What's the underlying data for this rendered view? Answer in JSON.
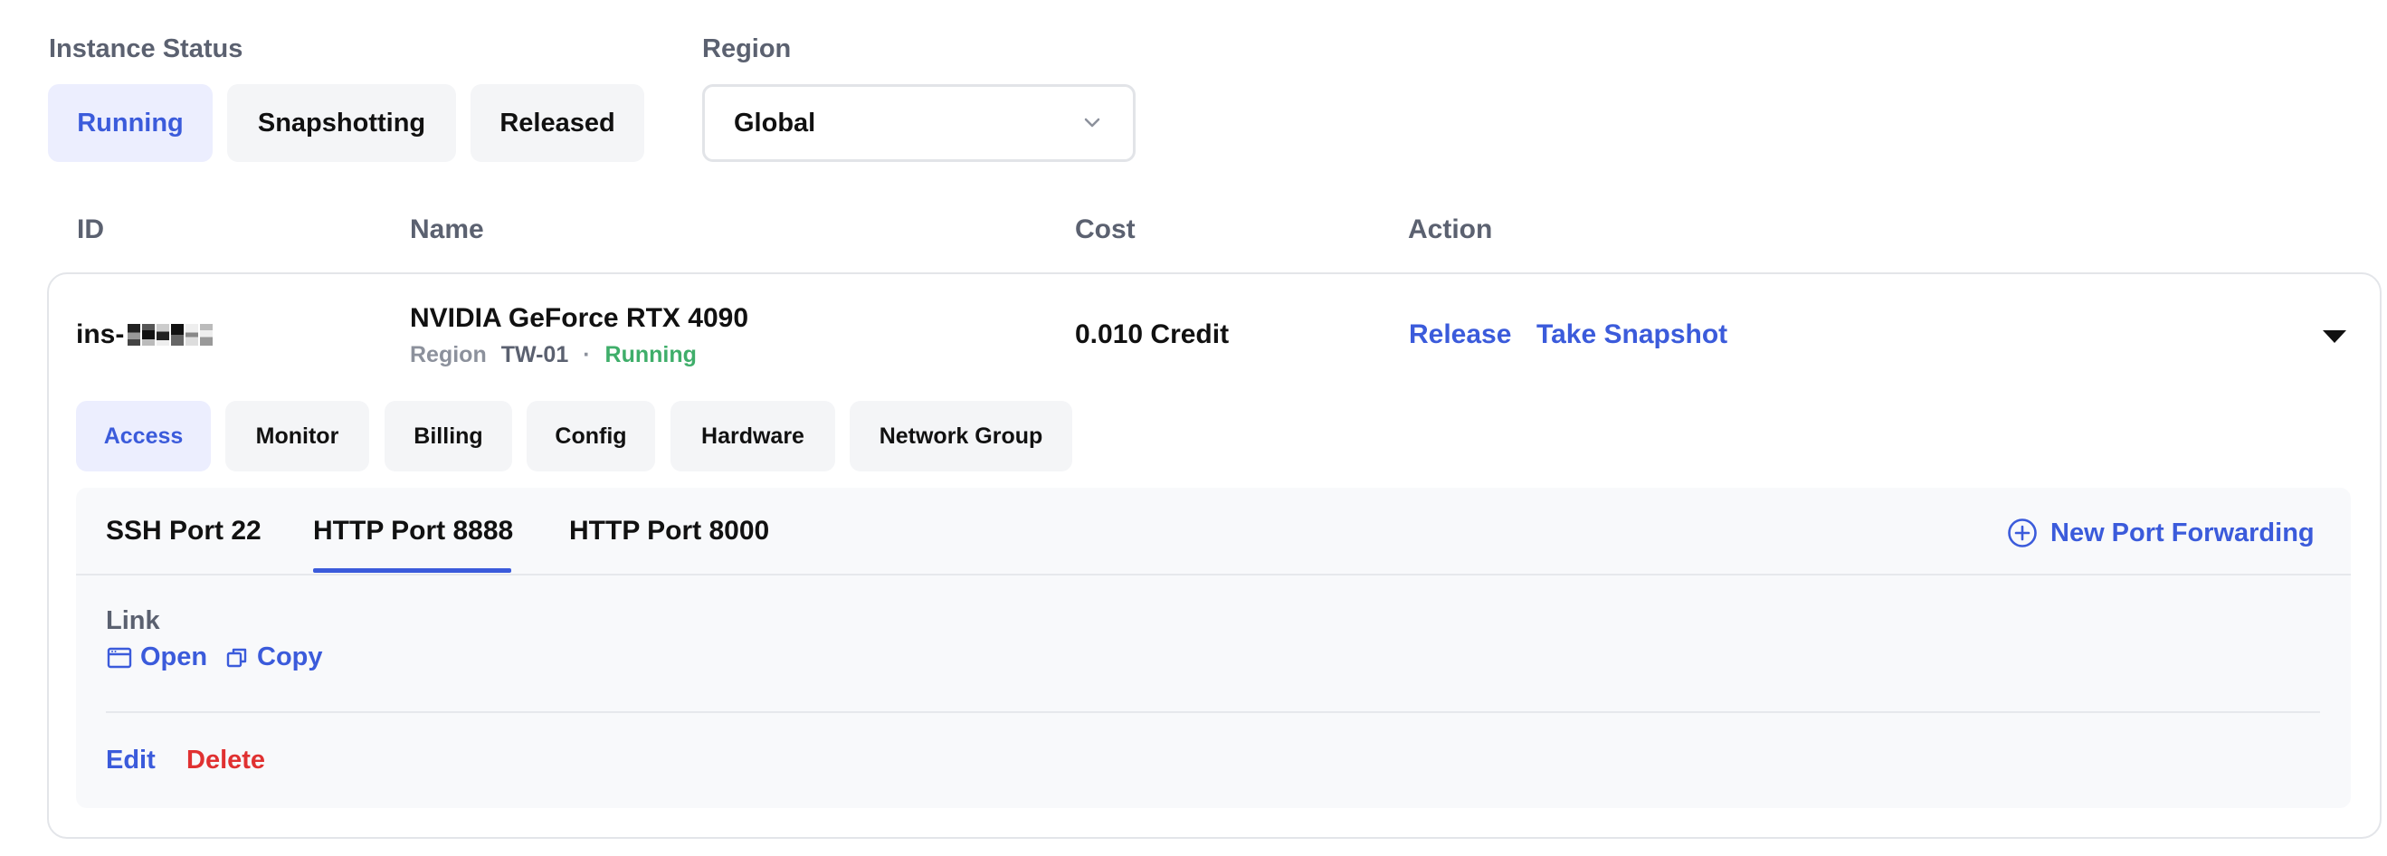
{
  "filters": {
    "status_label": "Instance Status",
    "status_options": [
      "Running",
      "Snapshotting",
      "Released"
    ],
    "active_status": "Running",
    "region_label": "Region",
    "region_value": "Global"
  },
  "table": {
    "headers": {
      "id": "ID",
      "name": "Name",
      "cost": "Cost",
      "action": "Action"
    }
  },
  "instance": {
    "id_prefix": "ins-",
    "gpu_name": "NVIDIA GeForce RTX 4090",
    "region_label": "Region",
    "region_code": "TW-01",
    "separator": "·",
    "status": "Running",
    "cost": "0.010 Credit",
    "actions": {
      "release": "Release",
      "snapshot": "Take Snapshot"
    }
  },
  "detail_tabs": [
    "Access",
    "Monitor",
    "Billing",
    "Config",
    "Hardware",
    "Network Group"
  ],
  "active_detail_tab": "Access",
  "ports": {
    "tabs": [
      "SSH Port 22",
      "HTTP Port 8888",
      "HTTP Port 8000"
    ],
    "active": "HTTP Port 8888",
    "new_label": "New Port Forwarding"
  },
  "link": {
    "label": "Link",
    "open_label": "Open",
    "copy_label": "Copy"
  },
  "footer_actions": {
    "edit": "Edit",
    "delete": "Delete"
  },
  "colors": {
    "accent": "#3b5bdb",
    "danger": "#e03131",
    "success": "#3fae6a"
  }
}
